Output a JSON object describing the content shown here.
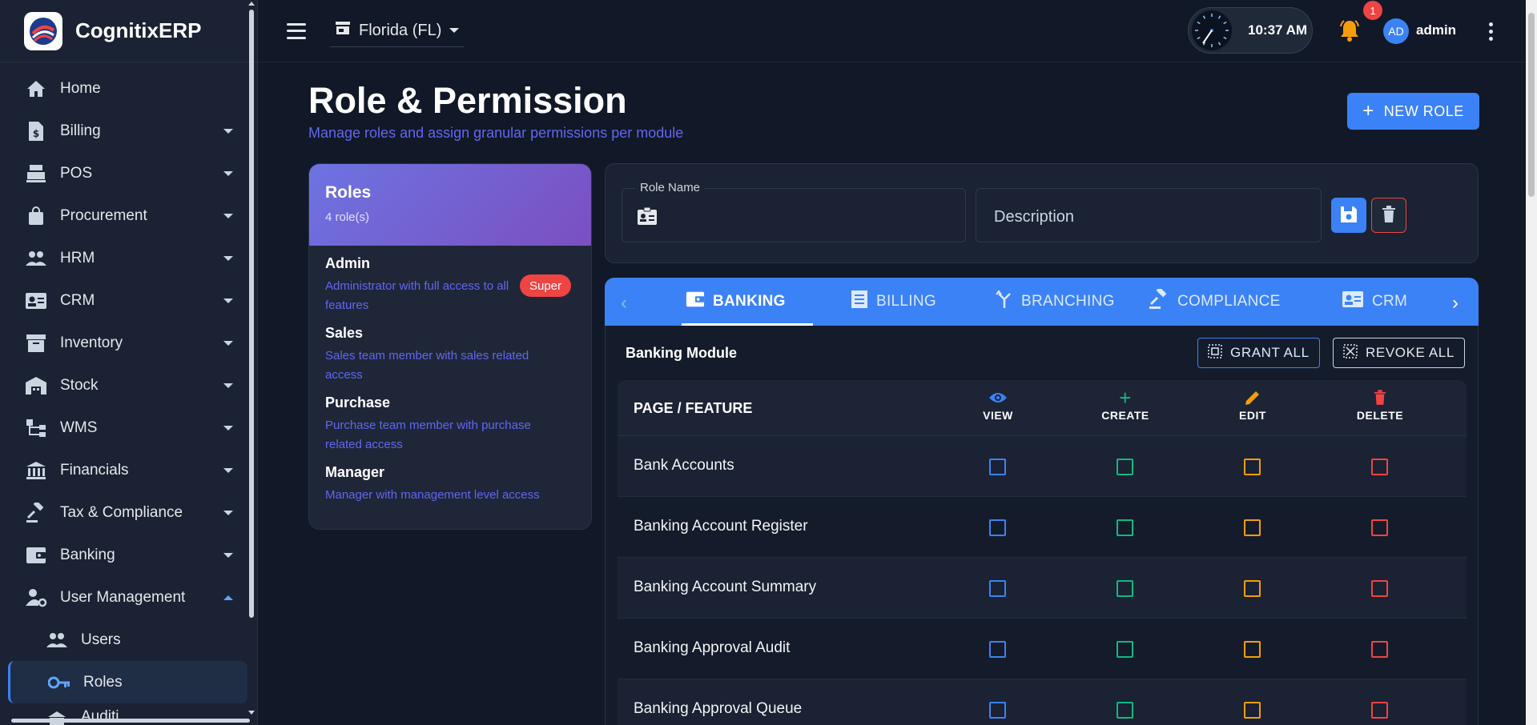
{
  "app": {
    "name": "CognitixERP"
  },
  "sidebar": {
    "items": [
      {
        "label": "Home",
        "icon": "home-icon",
        "expandable": false
      },
      {
        "label": "Billing",
        "icon": "invoice-dollar-icon",
        "expandable": true
      },
      {
        "label": "POS",
        "icon": "cash-register-icon",
        "expandable": true
      },
      {
        "label": "Procurement",
        "icon": "shopping-bag-icon",
        "expandable": true
      },
      {
        "label": "HRM",
        "icon": "people-icon",
        "expandable": true
      },
      {
        "label": "CRM",
        "icon": "contact-card-icon",
        "expandable": true
      },
      {
        "label": "Inventory",
        "icon": "archive-box-icon",
        "expandable": true
      },
      {
        "label": "Stock",
        "icon": "warehouse-icon",
        "expandable": true
      },
      {
        "label": "WMS",
        "icon": "hierarchy-icon",
        "expandable": true
      },
      {
        "label": "Financials",
        "icon": "bank-icon",
        "expandable": true
      },
      {
        "label": "Tax & Compliance",
        "icon": "gavel-icon",
        "expandable": true
      },
      {
        "label": "Banking",
        "icon": "wallet-icon",
        "expandable": true
      },
      {
        "label": "User Management",
        "icon": "user-gear-icon",
        "expandable": true,
        "expanded": true
      }
    ],
    "sub_items": [
      {
        "label": "Users",
        "icon": "people-icon"
      },
      {
        "label": "Roles",
        "icon": "key-icon",
        "active": true
      },
      {
        "label": "Auditi…",
        "icon": "audit-icon"
      }
    ]
  },
  "topbar": {
    "store": "Florida (FL)",
    "time": "10:37 AM",
    "notification_count": "1",
    "avatar_initials": "AD",
    "user": "admin"
  },
  "page": {
    "title": "Role & Permission",
    "subtitle": "Manage roles and assign granular permissions per module",
    "new_role_label": "NEW ROLE"
  },
  "roles_panel": {
    "title": "Roles",
    "count": "4 role(s)",
    "roles": [
      {
        "name": "Admin",
        "description": "Administrator with full access to all features",
        "badge": "Super"
      },
      {
        "name": "Sales",
        "description": "Sales team member with sales related access"
      },
      {
        "name": "Purchase",
        "description": "Purchase team member with purchase related access"
      },
      {
        "name": "Manager",
        "description": "Manager with management level access"
      }
    ]
  },
  "form": {
    "role_name_label": "Role Name",
    "role_name_value": "",
    "description_placeholder": "Description"
  },
  "tabs": [
    {
      "label": "BANKING",
      "icon": "wallet-icon",
      "active": true
    },
    {
      "label": "BILLING",
      "icon": "receipt-icon"
    },
    {
      "label": "BRANCHING",
      "icon": "merge-arrow-icon"
    },
    {
      "label": "COMPLIANCE",
      "icon": "gavel-icon"
    },
    {
      "label": "CRM",
      "icon": "contact-card-icon"
    }
  ],
  "module": {
    "title": "Banking Module",
    "grant_all": "GRANT ALL",
    "revoke_all": "REVOKE ALL",
    "columns": {
      "feature": "PAGE / FEATURE",
      "view": "VIEW",
      "create": "CREATE",
      "edit": "EDIT",
      "delete": "DELETE"
    },
    "colors": {
      "view": "#3b82f6",
      "create": "#10b981",
      "edit": "#f59e0b",
      "delete": "#ef4444"
    },
    "rows": [
      {
        "name": "Bank Accounts"
      },
      {
        "name": "Banking Account Register"
      },
      {
        "name": "Banking Account Summary"
      },
      {
        "name": "Banking Approval Audit"
      },
      {
        "name": "Banking Approval Queue"
      }
    ]
  }
}
